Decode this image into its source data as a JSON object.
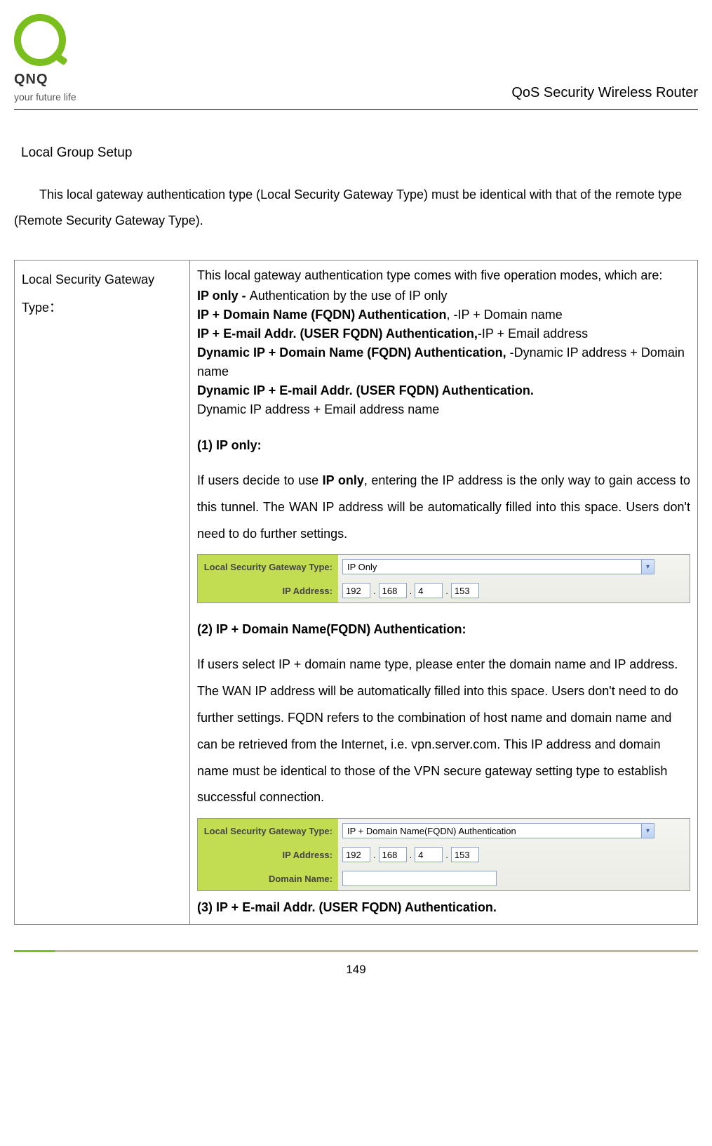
{
  "header": {
    "logo_text": "QNQ",
    "tagline": "your future life",
    "doc_title": "QoS Security Wireless Router"
  },
  "section": {
    "heading": "Local Group Setup",
    "intro": "This local gateway authentication type (Local Security Gateway Type) must be identical with that of the remote type (Remote Security Gateway Type)."
  },
  "table": {
    "left_label": "Local Security Gateway Type：",
    "modes_intro": "This local gateway authentication type comes with five operation modes, which are:",
    "modes": {
      "m1_b": "IP only - ",
      "m1_t": "Authentication by the use of IP only",
      "m2_b": "IP + Domain Name (FQDN) Authentication",
      "m2_t": ", -IP + Domain name",
      "m3_b": "IP + E-mail Addr. (USER FQDN) Authentication,",
      "m3_t": "-IP + Email address",
      "m4_b": "Dynamic IP + Domain Name (FQDN) Authentication, ",
      "m4_t": "-Dynamic IP address + Domain name",
      "m5_b": "Dynamic IP + E-mail Addr. (USER FQDN) Authentication.",
      "m5_t": "Dynamic IP address + Email address name"
    },
    "s1": {
      "head": "(1) IP only:",
      "body_a": "If users decide to use ",
      "body_bold": "IP only",
      "body_b": ", entering the IP address is the only way to gain access to this tunnel. The WAN IP address will be automatically filled into this space. Users don't need to do further settings.",
      "panel": {
        "row_type_label": "Local Security Gateway Type:",
        "row_type_value": "IP Only",
        "row_ip_label": "IP Address:",
        "ip": [
          "192",
          "168",
          "4",
          "153"
        ]
      }
    },
    "s2": {
      "head": "(2) IP + Domain Name(FQDN)    Authentication:",
      "body": "If users select IP + domain name type, please enter the domain name and IP address. The WAN IP address will be automatically filled into this space. Users don't need to do further settings. FQDN refers to the combination of host name and domain name and can be retrieved from the Internet, i.e. vpn.server.com. This IP address and domain name must be identical to those of the VPN secure gateway setting type to establish successful connection.",
      "panel": {
        "row_type_label": "Local Security Gateway Type:",
        "row_type_value": "IP + Domain Name(FQDN) Authentication",
        "row_ip_label": "IP Address:",
        "ip": [
          "192",
          "168",
          "4",
          "153"
        ],
        "row_domain_label": "Domain Name:"
      }
    },
    "s3": {
      "head": "(3) IP + E-mail Addr. (USER FQDN) Authentication."
    }
  },
  "footer": {
    "page_num": "149"
  }
}
